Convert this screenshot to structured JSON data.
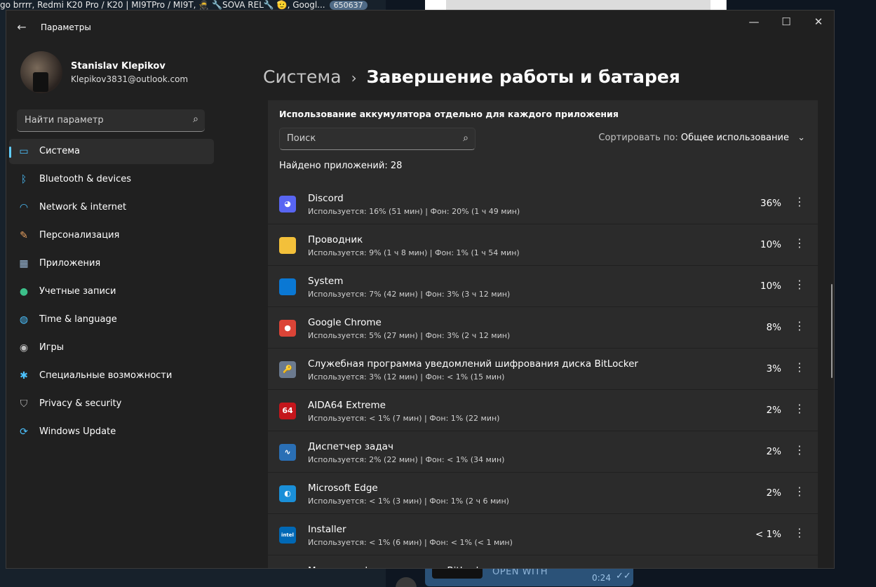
{
  "background": {
    "top_chat_text": "go brrrr, Redmi K20 Pro / K20 | MI9TPro / MI9T, 🥷 🔧SOVA REL🔧 🫡, Googl...",
    "top_chat_count": "650637",
    "bottom_open_label": "OPEN WITH",
    "bottom_time": "0:24",
    "bottom_check": "✓✓"
  },
  "window": {
    "title": "Параметры",
    "back_icon": "arrow-left-icon",
    "controls": {
      "minimize": "—",
      "maximize": "☐",
      "close": "✕"
    }
  },
  "profile": {
    "name": "Stanislav Klepikov",
    "email": "Klepikov3831@outlook.com"
  },
  "sidebar": {
    "search_placeholder": "Найти параметр",
    "items": [
      {
        "label": "Система",
        "icon": "monitor-icon",
        "glyph": "▭",
        "color": "#4cc2ff",
        "active": true
      },
      {
        "label": "Bluetooth & devices",
        "icon": "bluetooth-icon",
        "glyph": "ᛒ",
        "color": "#4cc2ff",
        "active": false
      },
      {
        "label": "Network & internet",
        "icon": "wifi-icon",
        "glyph": "◠",
        "color": "#4cc2ff",
        "active": false
      },
      {
        "label": "Персонализация",
        "icon": "brush-icon",
        "glyph": "✎",
        "color": "#e8a060",
        "active": false
      },
      {
        "label": "Приложения",
        "icon": "apps-icon",
        "glyph": "▦",
        "color": "#9ab8d6",
        "active": false
      },
      {
        "label": "Учетные записи",
        "icon": "account-icon",
        "glyph": "●",
        "color": "#3cc08a",
        "active": false
      },
      {
        "label": "Time & language",
        "icon": "globe-icon",
        "glyph": "◍",
        "color": "#4cc2ff",
        "active": false
      },
      {
        "label": "Игры",
        "icon": "gamepad-icon",
        "glyph": "◉",
        "color": "#bdbdbd",
        "active": false
      },
      {
        "label": "Специальные возможности",
        "icon": "accessibility-icon",
        "glyph": "✱",
        "color": "#4cc2ff",
        "active": false
      },
      {
        "label": "Privacy & security",
        "icon": "shield-icon",
        "glyph": "⛉",
        "color": "#bdbdbd",
        "active": false
      },
      {
        "label": "Windows Update",
        "icon": "update-icon",
        "glyph": "⟳",
        "color": "#4cc2ff",
        "active": false
      }
    ]
  },
  "breadcrumb": {
    "parent": "Система",
    "separator": "›",
    "current": "Завершение работы и батарея"
  },
  "battery_usage": {
    "title": "Использование аккумулятора отдельно для каждого приложения",
    "search_placeholder": "Поиск",
    "sort_label": "Сортировать по:",
    "sort_value": "Общее использование",
    "found_text": "Найдено приложений: 28",
    "apps": [
      {
        "name": "Discord",
        "desc": "Используется: 16% (51 мин) | Фон: 20% (1 ч 49 мин)",
        "pct": "36%",
        "icon": "discord-icon",
        "glyph": "◕",
        "bg": "#5865f2"
      },
      {
        "name": "Проводник",
        "desc": "Используется: 9% (1 ч 8 мин) | Фон: 1% (1 ч 54 мин)",
        "pct": "10%",
        "icon": "folder-icon",
        "glyph": "",
        "bg": "#f3c03a"
      },
      {
        "name": "System",
        "desc": "Используется: 7% (42 мин) | Фон: 3% (3 ч 12 мин)",
        "pct": "10%",
        "icon": "system-icon",
        "glyph": "",
        "bg": "#0a78d4"
      },
      {
        "name": "Google Chrome",
        "desc": "Используется: 5% (27 мин) | Фон: 3% (2 ч 12 мин)",
        "pct": "8%",
        "icon": "chrome-icon",
        "glyph": "●",
        "bg": "#db4437"
      },
      {
        "name": "Служебная программа уведомлений шифрования диска BitLocker",
        "desc": "Используется: 3% (12 мин) | Фон: < 1% (15 мин)",
        "pct": "3%",
        "icon": "bitlocker-icon",
        "glyph": "🔑",
        "bg": "#6b7a8f"
      },
      {
        "name": "AIDA64 Extreme",
        "desc": "Используется: < 1% (7 мин) | Фон: 1% (22 мин)",
        "pct": "2%",
        "icon": "aida64-icon",
        "glyph": "64",
        "bg": "#c4161c"
      },
      {
        "name": "Диспетчер задач",
        "desc": "Используется: 2% (22 мин) | Фон: < 1% (34 мин)",
        "pct": "2%",
        "icon": "task-manager-icon",
        "glyph": "∿",
        "bg": "#2a6fb5"
      },
      {
        "name": "Microsoft Edge",
        "desc": "Используется: < 1% (3 мин) | Фон: 1% (2 ч 6 мин)",
        "pct": "2%",
        "icon": "edge-icon",
        "glyph": "◐",
        "bg": "#1a8fd8"
      },
      {
        "name": "Installer",
        "desc": "Используется: < 1% (6 мин) | Фон: < 1% (< 1 мин)",
        "pct": "< 1%",
        "icon": "intel-icon",
        "glyph": "intel",
        "bg": "#0068b5"
      },
      {
        "name": "Мастер шифрования диска BitLocker",
        "desc": "",
        "pct": "",
        "icon": "bitlocker-wizard-icon",
        "glyph": "",
        "bg": "#3b7fd0"
      }
    ],
    "more_glyph": "⋮"
  }
}
